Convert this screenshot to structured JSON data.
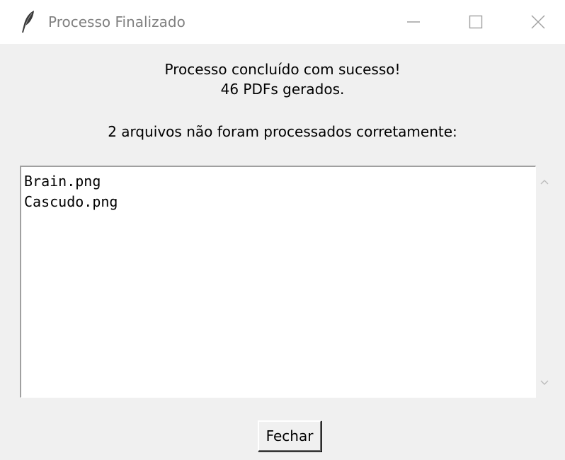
{
  "window": {
    "title": "Processo Finalizado",
    "icon": "feather-icon"
  },
  "title_controls": {
    "minimize_icon": "minimize-icon",
    "maximize_icon": "maximize-icon",
    "close_icon": "close-icon"
  },
  "message": {
    "line1": "Processo concluído com sucesso!",
    "line2": "46 PDFs gerados.",
    "line3": "2 arquivos não foram processados corretamente:"
  },
  "failed_files": {
    "items": [
      "Brain.png",
      "Cascudo.png"
    ]
  },
  "scrollbar": {
    "up_icon": "chevron-up-icon",
    "down_icon": "chevron-down-icon"
  },
  "actions": {
    "close_label": "Fechar"
  }
}
